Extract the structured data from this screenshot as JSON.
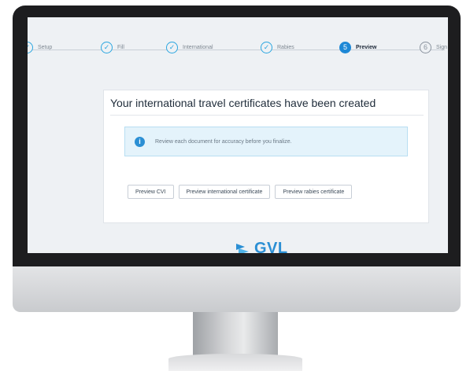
{
  "stepper": {
    "steps": [
      {
        "label": "Setup",
        "state": "done"
      },
      {
        "label": "Fill",
        "state": "done"
      },
      {
        "label": "International",
        "state": "done"
      },
      {
        "label": "Rabies",
        "state": "done"
      },
      {
        "label": "Preview",
        "state": "active",
        "number": "5"
      },
      {
        "label": "Sign",
        "state": "pending",
        "number": "6"
      }
    ],
    "done_glyph": "✓"
  },
  "card": {
    "title": "Your international travel certificates have been created",
    "alert_icon": "i",
    "alert_text": "Review each document for accuracy before you finalize.",
    "buttons": {
      "preview_cvi": "Preview CVI",
      "preview_international": "Preview international certificate",
      "preview_rabies": "Preview rabies certificate"
    }
  },
  "logo": {
    "text": "GVL"
  },
  "colors": {
    "accent": "#2b8fd4",
    "bezel": "#1d1d1f",
    "screen_bg": "#eef1f4"
  }
}
